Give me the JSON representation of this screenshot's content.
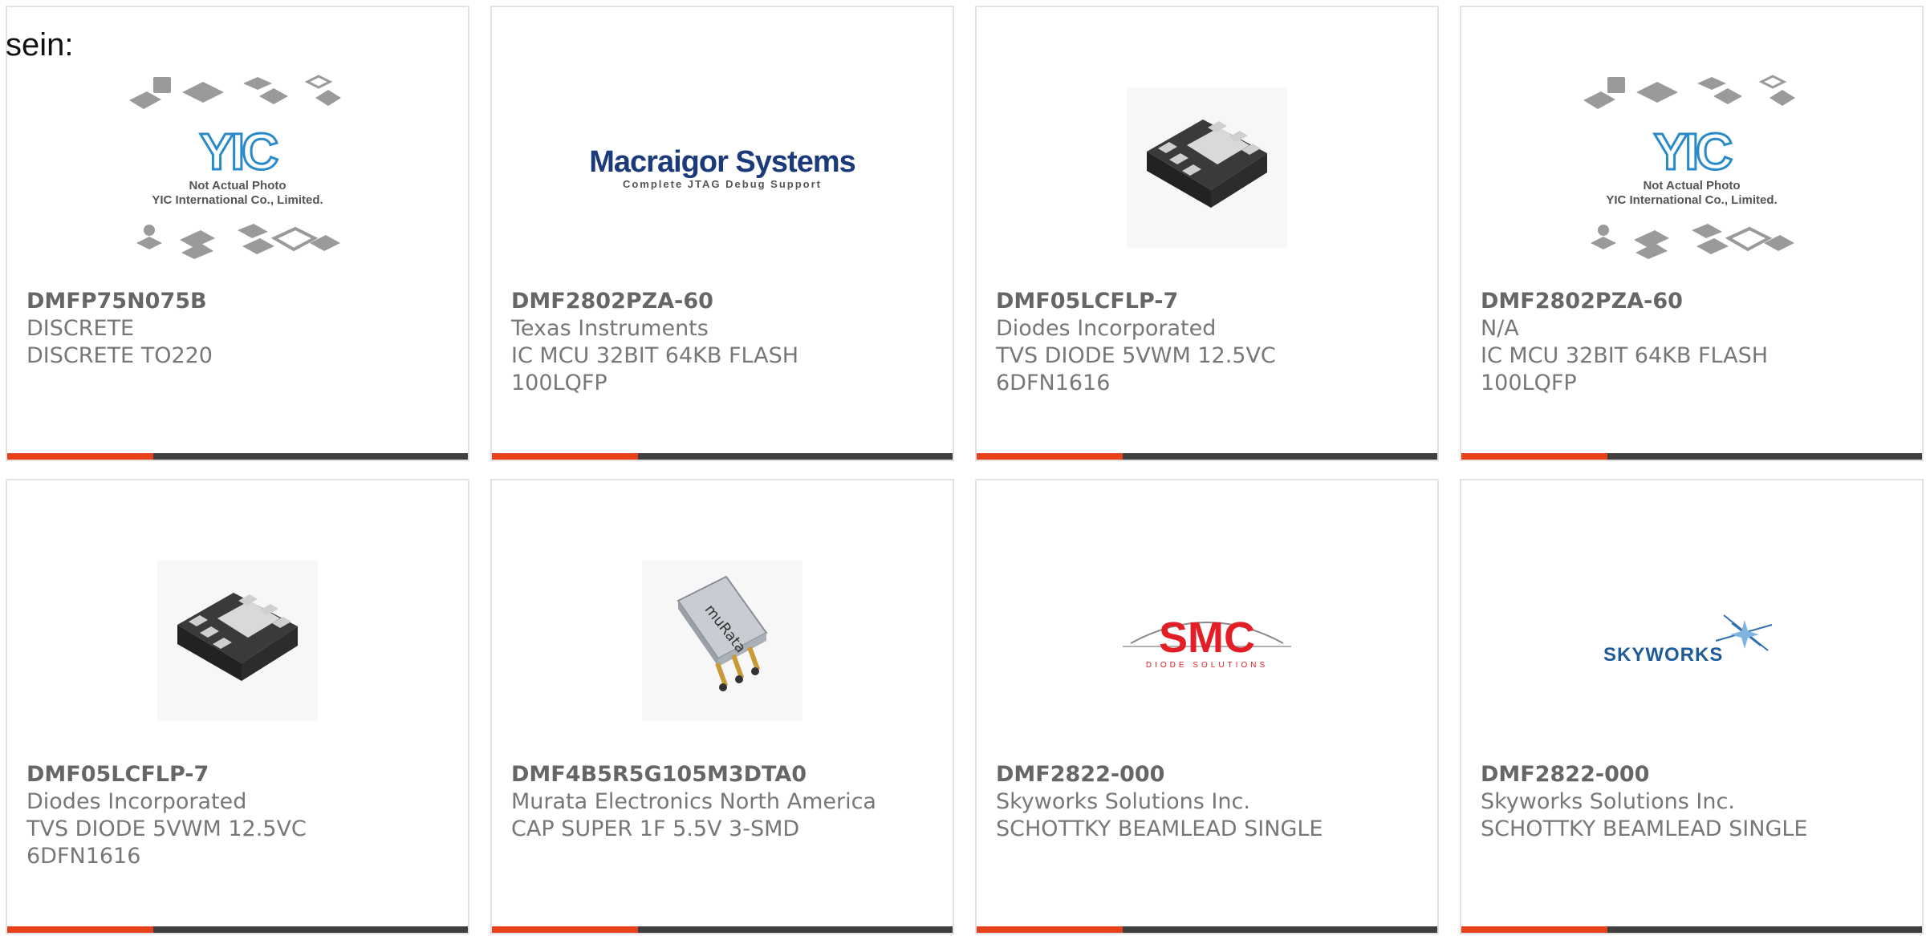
{
  "lead_text": "sein:",
  "colors": {
    "accent": "#e8401c",
    "bar": "#3f3f3f"
  },
  "placeholder": {
    "line1": "Not Actual Photo",
    "line2": "YIC International Co., Limited.",
    "logo": "YIC"
  },
  "logos": {
    "macraigor": {
      "name": "Macraigor Systems",
      "tagline": "Complete JTAG Debug Support"
    },
    "smc": {
      "name": "SMC",
      "tagline": "DIODE SOLUTIONS"
    },
    "skyworks": {
      "name": "SKYWORKS"
    },
    "murata": {
      "name": "muRata"
    }
  },
  "products": [
    {
      "pn": "DMFP75N075B",
      "mfr": "DISCRETE",
      "desc1": "DISCRETE TO220",
      "desc2": "",
      "image": "placeholder-yic"
    },
    {
      "pn": "DMF2802PZA-60",
      "mfr": "Texas Instruments",
      "desc1": "IC MCU 32BIT 64KB FLASH",
      "desc2": "100LQFP",
      "image": "macraigor-logo"
    },
    {
      "pn": "DMF05LCFLP-7",
      "mfr": "Diodes Incorporated",
      "desc1": "TVS DIODE 5VWM 12.5VC",
      "desc2": "6DFN1616",
      "image": "dfn-chip"
    },
    {
      "pn": "DMF2802PZA-60",
      "mfr": "N/A",
      "desc1": "IC MCU 32BIT 64KB FLASH",
      "desc2": "100LQFP",
      "image": "placeholder-yic"
    },
    {
      "pn": "DMF05LCFLP-7",
      "mfr": "Diodes Incorporated",
      "desc1": "TVS DIODE 5VWM 12.5VC",
      "desc2": "6DFN1616",
      "image": "dfn-chip"
    },
    {
      "pn": "DMF4B5R5G105M3DTA0",
      "mfr": "Murata Electronics North America",
      "desc1": "CAP SUPER 1F 5.5V 3-SMD",
      "desc2": "",
      "image": "supercap"
    },
    {
      "pn": "DMF2822-000",
      "mfr": "Skyworks Solutions Inc.",
      "desc1": "SCHOTTKY BEAMLEAD SINGLE",
      "desc2": "",
      "image": "smc-logo"
    },
    {
      "pn": "DMF2822-000",
      "mfr": "Skyworks Solutions Inc.",
      "desc1": "SCHOTTKY BEAMLEAD SINGLE",
      "desc2": "",
      "image": "skyworks-logo"
    }
  ]
}
